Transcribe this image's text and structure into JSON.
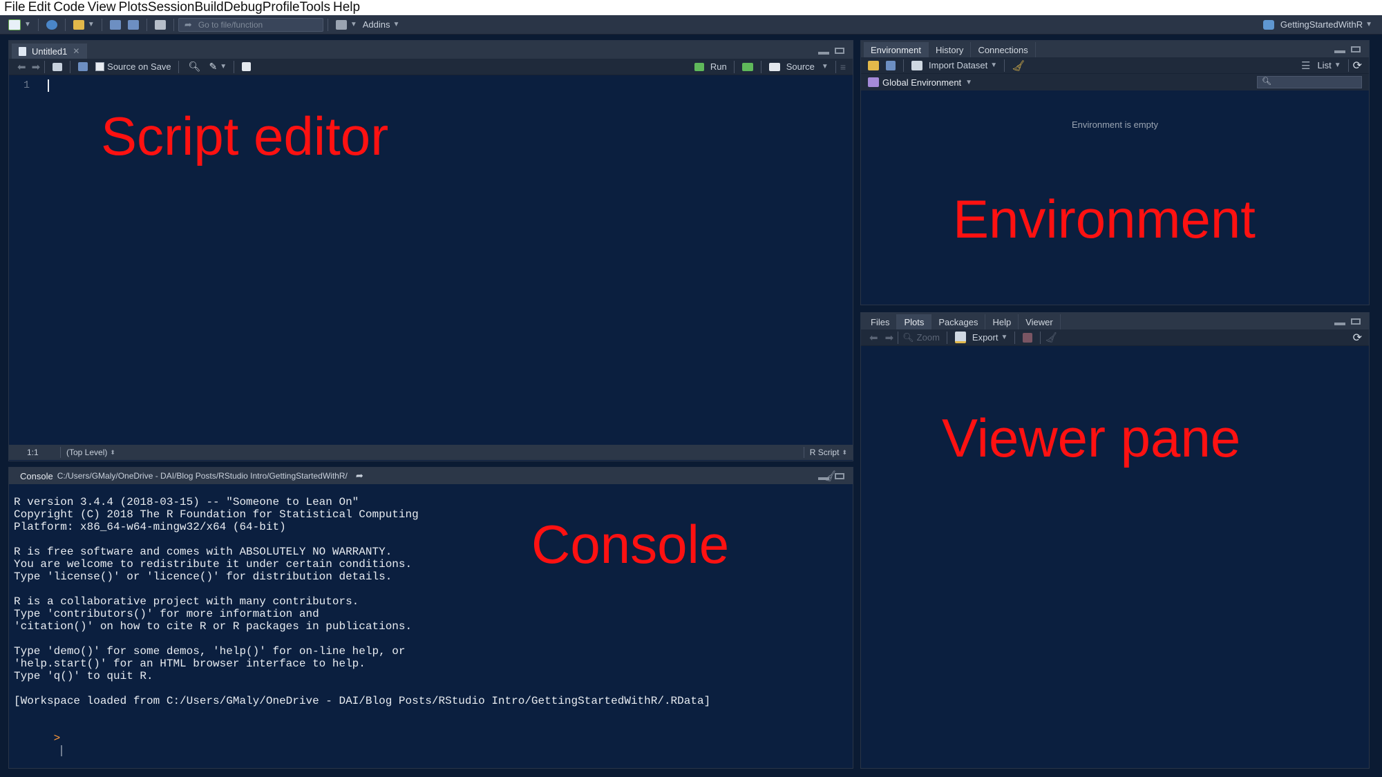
{
  "menu": [
    "File",
    "Edit",
    "Code",
    "View",
    "Plots",
    "Session",
    "Build",
    "Debug",
    "Profile",
    "Tools",
    "Help"
  ],
  "toolbar": {
    "goto_placeholder": "Go to file/function",
    "addins_label": "Addins",
    "project_label": "GettingStartedWithR"
  },
  "editor": {
    "tab_label": "Untitled1",
    "source_on_save": "Source on Save",
    "run_label": "Run",
    "source_label": "Source",
    "line_number": "1",
    "overlay_label": "Script editor",
    "status_position": "1:1",
    "status_scope": "(Top Level)",
    "status_type": "R Script"
  },
  "console": {
    "title": "Console",
    "path": "C:/Users/GMaly/OneDrive - DAI/Blog Posts/RStudio Intro/GettingStartedWithR/",
    "overlay_label": "Console",
    "lines": [
      "R version 3.4.4 (2018-03-15) -- \"Someone to Lean On\"",
      "Copyright (C) 2018 The R Foundation for Statistical Computing",
      "Platform: x86_64-w64-mingw32/x64 (64-bit)",
      "",
      "R is free software and comes with ABSOLUTELY NO WARRANTY.",
      "You are welcome to redistribute it under certain conditions.",
      "Type 'license()' or 'licence()' for distribution details.",
      "",
      "R is a collaborative project with many contributors.",
      "Type 'contributors()' for more information and",
      "'citation()' on how to cite R or R packages in publications.",
      "",
      "Type 'demo()' for some demos, 'help()' for on-line help, or",
      "'help.start()' for an HTML browser interface to help.",
      "Type 'q()' to quit R.",
      "",
      "[Workspace loaded from C:/Users/GMaly/OneDrive - DAI/Blog Posts/RStudio Intro/GettingStartedWithR/.RData]"
    ],
    "prompt": ">"
  },
  "environment": {
    "tabs": [
      "Environment",
      "History",
      "Connections"
    ],
    "import_label": "Import Dataset",
    "list_label": "List",
    "scope_label": "Global Environment",
    "empty_message": "Environment is empty",
    "overlay_label": "Environment"
  },
  "viewer": {
    "tabs": [
      "Files",
      "Plots",
      "Packages",
      "Help",
      "Viewer"
    ],
    "zoom_label": "Zoom",
    "export_label": "Export",
    "overlay_label": "Viewer pane"
  },
  "colors": {
    "overlay": "#ff1111",
    "pane_background": "#0b1f3f",
    "prompt": "#ff9a3c"
  }
}
